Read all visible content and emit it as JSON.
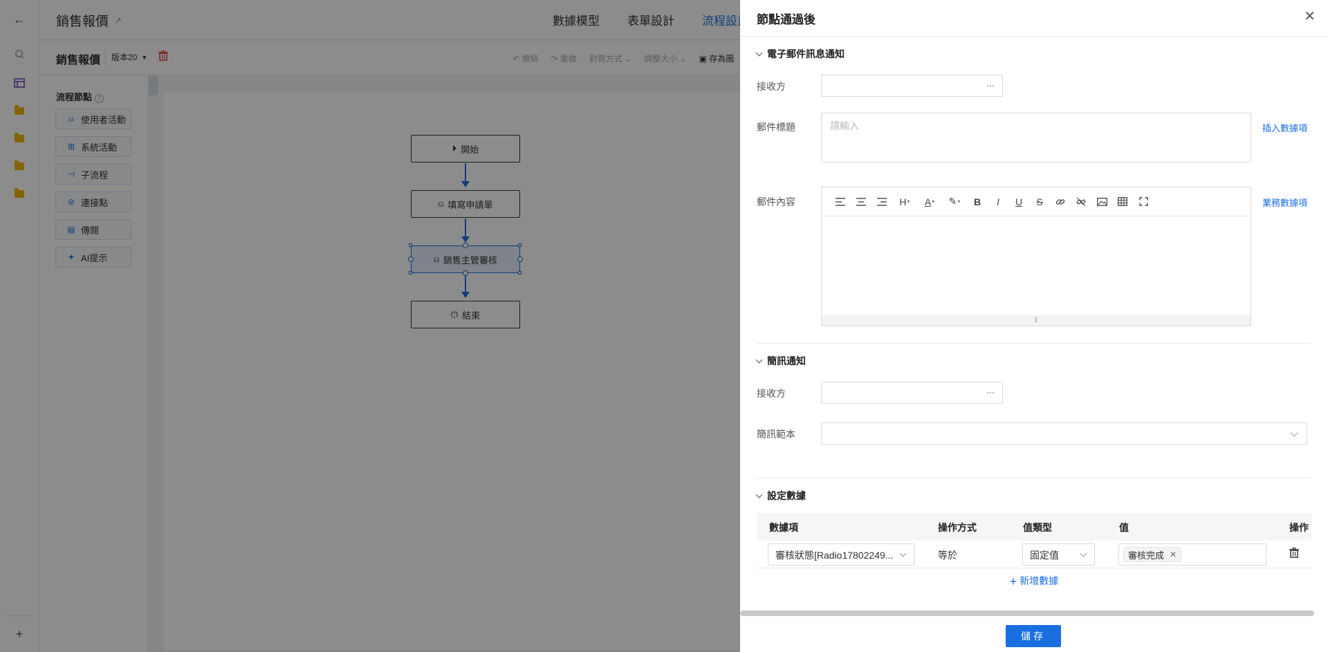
{
  "app": {
    "title": "銷售報價",
    "tabs": [
      "數據模型",
      "表單設計",
      "流程設計"
    ],
    "form_name": "銷售報價",
    "version": "版本20",
    "toolbar": [
      "撤銷",
      "重做",
      "對齊方式",
      "調整大小",
      "存為圖"
    ]
  },
  "palette": {
    "title": "流程節點",
    "items": [
      "使用者活動",
      "系統活動",
      "子流程",
      "連接點",
      "傳閱",
      "AI提示"
    ]
  },
  "flow": {
    "nodes": [
      "開始",
      "填寫申請單",
      "銷售主管審核",
      "結束"
    ]
  },
  "drawer": {
    "title": "節點通過後",
    "email_section": {
      "title": "電子郵件訊息通知",
      "recipient_label": "接收方",
      "subject_label": "郵件標題",
      "subject_placeholder": "請輸入",
      "insert_link": "插入數據項",
      "content_label": "郵件內容",
      "business_link": "業務數據項"
    },
    "sms_section": {
      "title": "簡訊通知",
      "recipient_label": "接收方",
      "template_label": "簡訊範本"
    },
    "data_section": {
      "title": "設定數據",
      "columns": [
        "數據項",
        "操作方式",
        "值類型",
        "值",
        "操作"
      ],
      "rows": [
        {
          "field": "審核狀態[Radio17802249...",
          "operator": "等於",
          "value_type": "固定值",
          "value_tag": "審核完成"
        }
      ],
      "add_label": "新增數據"
    },
    "save_label": "儲存"
  },
  "colors": {
    "accent": "#1a6fe0",
    "danger": "#e03b3b",
    "folder": "#f0b400"
  }
}
